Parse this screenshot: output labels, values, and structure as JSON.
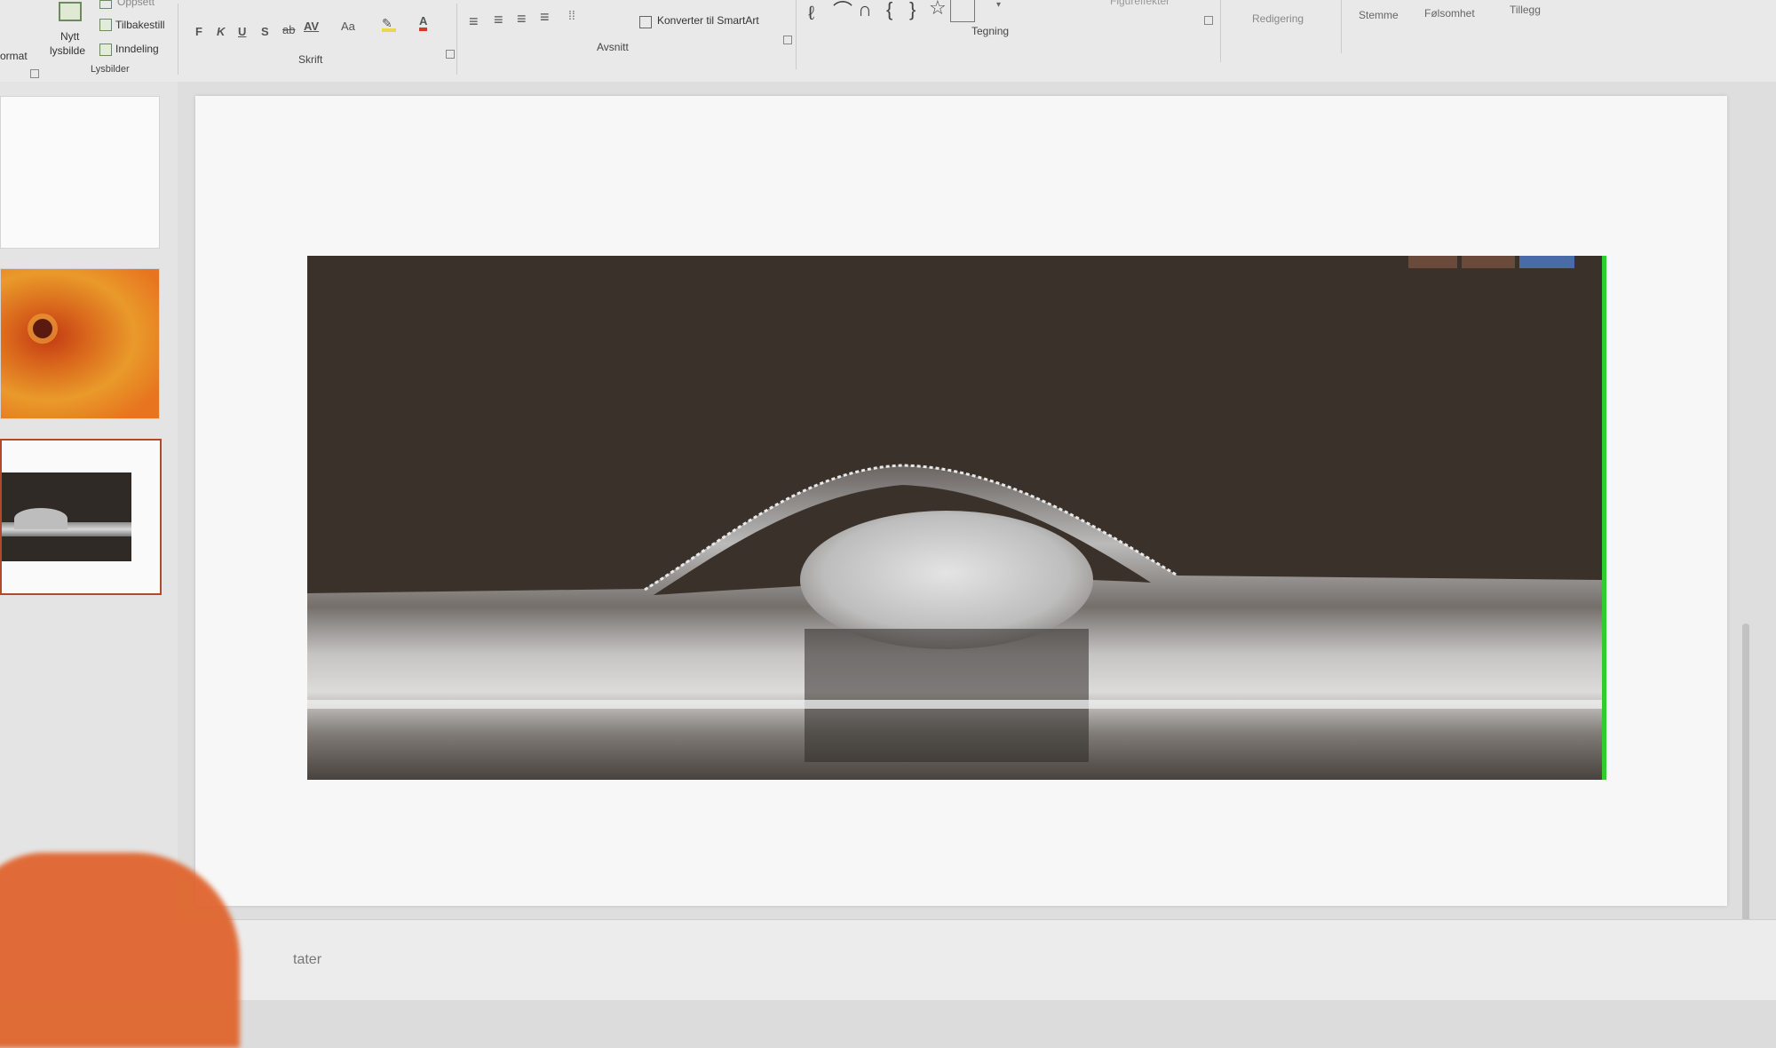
{
  "ribbon": {
    "lysbilder_group": {
      "format_label": "ormat",
      "new_slide_label_1": "Nytt",
      "new_slide_label_2": "lysbilde",
      "oppsett_label": "Oppsett",
      "reset_label": "Tilbakestill",
      "section_label": "Inndeling",
      "group_label": "Lysbilder"
    },
    "font_group": {
      "bold": "F",
      "italic": "K",
      "underline": "U",
      "shadow": "S",
      "strike": "ab",
      "spacing": "AV",
      "case": "Aa",
      "color": "A",
      "group_label": "Skrift"
    },
    "paragraph_group": {
      "smartart_label": "Konverter til SmartArt",
      "group_label": "Avsnitt"
    },
    "drawing_group": {
      "shape_effects_label": "Figureffekter",
      "group_label": "Tegning"
    },
    "editing_group": {
      "group_label": "Redigering"
    },
    "other_tabs": [
      "Stemme",
      "Følsomhet",
      "Tillegg"
    ]
  },
  "notes": {
    "label": "tater"
  }
}
